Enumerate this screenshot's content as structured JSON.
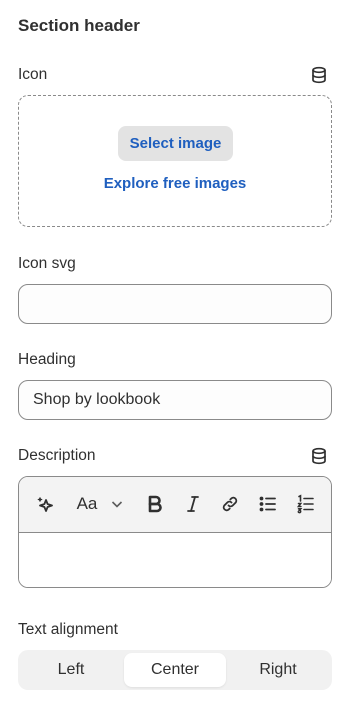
{
  "section": {
    "title": "Section header"
  },
  "icon_field": {
    "label": "Icon",
    "select_button": "Select image",
    "explore_link": "Explore free images",
    "dynamic_source_icon": "database-icon"
  },
  "icon_svg_field": {
    "label": "Icon svg",
    "value": ""
  },
  "heading_field": {
    "label": "Heading",
    "value": "Shop by lookbook"
  },
  "description_field": {
    "label": "Description",
    "dynamic_source_icon": "database-icon",
    "toolbar": [
      "magic-icon",
      "font-size-icon",
      "chevron-down-icon",
      "bold-icon",
      "italic-icon",
      "link-icon",
      "bulleted-list-icon",
      "numbered-list-icon"
    ],
    "font_button_glyph": "Aa",
    "value": ""
  },
  "alignment_field": {
    "label": "Text alignment",
    "options": [
      "Left",
      "Center",
      "Right"
    ],
    "selected": "Center"
  },
  "colors": {
    "link": "#1f5fbf",
    "text": "#303030",
    "border": "#8a8a8a"
  }
}
